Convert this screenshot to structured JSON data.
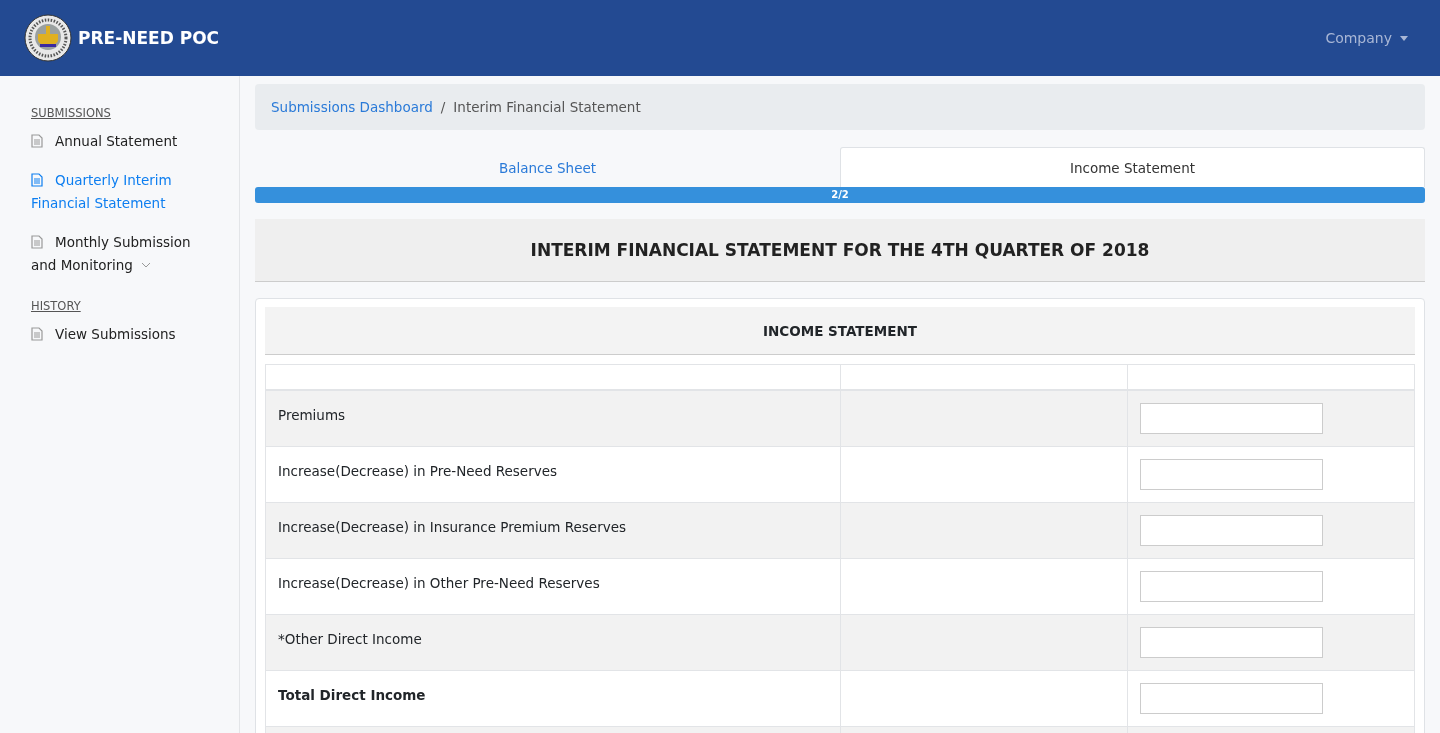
{
  "navbar": {
    "brand": "PRE-NEED POC",
    "menu": "Company"
  },
  "sidebar": {
    "sections": [
      {
        "heading": "SUBMISSIONS",
        "items": [
          {
            "label": "Annual Statement",
            "selected": false,
            "expandable": false
          },
          {
            "label": "Quarterly Interim Financial Statement",
            "selected": true,
            "expandable": false
          },
          {
            "label": "Monthly Submission and Monitoring",
            "selected": false,
            "expandable": true
          }
        ]
      },
      {
        "heading": "HISTORY",
        "items": [
          {
            "label": "View Submissions",
            "selected": false,
            "expandable": false
          }
        ]
      }
    ]
  },
  "breadcrumb": {
    "separator": "/",
    "items": [
      {
        "label": "Submissions Dashboard",
        "kind": "link"
      },
      {
        "label": "Interim Financial Statement",
        "kind": "current"
      }
    ]
  },
  "tabs": [
    {
      "label": "Balance Sheet",
      "selected": false
    },
    {
      "label": "Income Statement",
      "selected": true
    }
  ],
  "progress": {
    "level": 1,
    "label": "2/2"
  },
  "title": "INTERIM FINANCIAL STATEMENT FOR THE 4TH QUARTER OF 2018",
  "card": {
    "heading": "INCOME STATEMENT",
    "rows": [
      {
        "label": "Premiums",
        "kind": "item"
      },
      {
        "label": "Increase(Decrease) in Pre-Need Reserves",
        "kind": "item"
      },
      {
        "label": "Increase(Decrease) in Insurance Premium Reserves",
        "kind": "item"
      },
      {
        "label": "Increase(Decrease) in Other Pre-Need Reserves",
        "kind": "item"
      },
      {
        "label": "*Other Direct Income",
        "kind": "item"
      },
      {
        "label": "Total Direct Income",
        "kind": "total"
      }
    ]
  }
}
